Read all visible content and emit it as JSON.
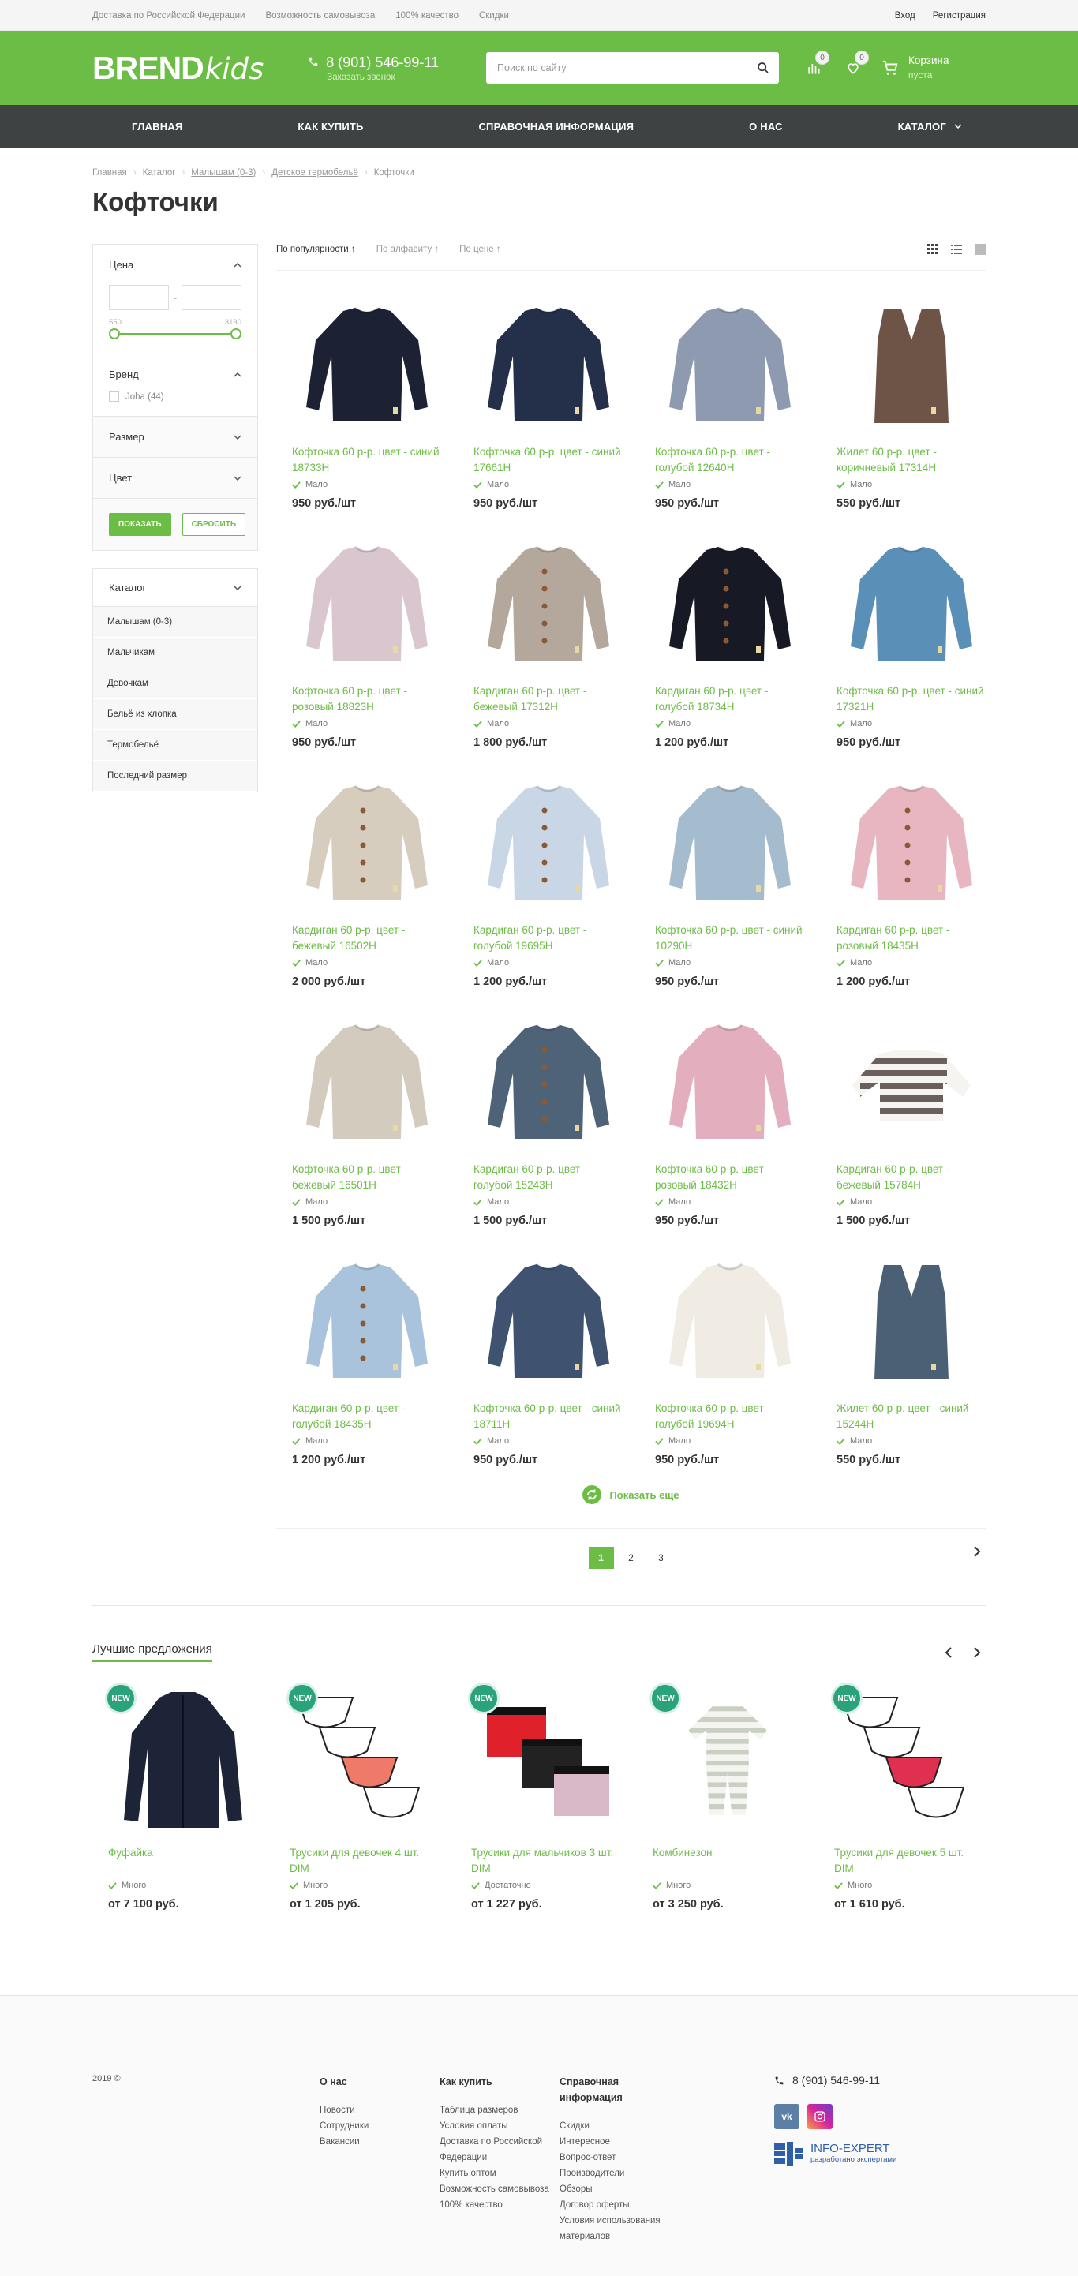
{
  "topbar": {
    "links": [
      "Доставка по Российской Федерации",
      "Возможность самовывоза",
      "100% качество",
      "Скидки"
    ],
    "login": "Вход",
    "register": "Регистрация"
  },
  "header": {
    "logo_brand": "BREND",
    "logo_kids": "kids",
    "phone": "8 (901) 546-99-11",
    "callback": "Заказать звонок",
    "search_placeholder": "Поиск по сайту",
    "compare_count": "0",
    "wishlist_count": "0",
    "cart_title": "Корзина",
    "cart_status": "пуста"
  },
  "nav": [
    "ГЛАВНАЯ",
    "КАК КУПИТЬ",
    "СПРАВОЧНАЯ ИНФОРМАЦИЯ",
    "О НАС",
    "КАТАЛОГ"
  ],
  "breadcrumbs": [
    "Главная",
    "Каталог",
    "Малышам (0-3)",
    "Детское термобельё",
    "Кофточки"
  ],
  "page_title": "Кофточки",
  "filter": {
    "price_label": "Цена",
    "price_min": "550",
    "price_max": "3130",
    "brand_label": "Бренд",
    "brand_option": "Joha (44)",
    "size_label": "Размер",
    "color_label": "Цвет",
    "show_button": "ПОКАЗАТЬ",
    "reset_button": "СБРОСИТЬ"
  },
  "catalog": {
    "title": "Каталог",
    "items": [
      "Малышам (0-3)",
      "Мальчикам",
      "Девочкам",
      "Бельё из хлопка",
      "Термобельё",
      "Последний размер"
    ]
  },
  "sort": {
    "popularity": "По популярности",
    "alphabet": "По алфавиту",
    "price": "По цене"
  },
  "products": [
    {
      "name": "Кофточка 60 р-р. цвет - синий 18733H",
      "avail": "Мало",
      "price": "950 руб./шт",
      "color": "#1c2233",
      "kind": "sweater"
    },
    {
      "name": "Кофточка 60 р-р. цвет - синий 17661H",
      "avail": "Мало",
      "price": "950 руб./шт",
      "color": "#242f4a",
      "kind": "sweater"
    },
    {
      "name": "Кофточка 60 р-р. цвет - голубой 12640H",
      "avail": "Мало",
      "price": "950 руб./шт",
      "color": "#8d9ab0",
      "kind": "sweater"
    },
    {
      "name": "Жилет 60 р-р. цвет - коричневый 17314H",
      "avail": "Мало",
      "price": "550 руб./шт",
      "color": "#6d5446",
      "kind": "vest"
    },
    {
      "name": "Кофточка 60 р-р. цвет - розовый 18823H",
      "avail": "Мало",
      "price": "950 руб./шт",
      "color": "#d9c6cf",
      "kind": "sweater"
    },
    {
      "name": "Кардиган 60 р-р. цвет - бежевый 17312H",
      "avail": "Мало",
      "price": "1 800 руб./шт",
      "color": "#b4a79c",
      "kind": "cardigan"
    },
    {
      "name": "Кардиган 60 р-р. цвет - голубой 18734H",
      "avail": "Мало",
      "price": "1 200 руб./шт",
      "color": "#171a25",
      "kind": "cardigan"
    },
    {
      "name": "Кофточка 60 р-р. цвет - синий 17321H",
      "avail": "Мало",
      "price": "950 руб./шт",
      "color": "#5a8fb8",
      "kind": "sweater"
    },
    {
      "name": "Кардиган 60 р-р. цвет - бежевый 16502H",
      "avail": "Мало",
      "price": "2 000 руб./шт",
      "color": "#d6cdbf",
      "kind": "cardigan"
    },
    {
      "name": "Кардиган 60 р-р. цвет - голубой 19695H",
      "avail": "Мало",
      "price": "1 200 руб./шт",
      "color": "#c9d6e6",
      "kind": "cardigan"
    },
    {
      "name": "Кофточка 60 р-р. цвет - синий 10290H",
      "avail": "Мало",
      "price": "950 руб./шт",
      "color": "#a4bccd",
      "kind": "sweater"
    },
    {
      "name": "Кардиган 60 р-р. цвет - розовый 18435H",
      "avail": "Мало",
      "price": "1 200 руб./шт",
      "color": "#e8b6c0",
      "kind": "cardigan"
    },
    {
      "name": "Кофточка 60 р-р. цвет - бежевый 16501H",
      "avail": "Мало",
      "price": "1 500 руб./шт",
      "color": "#d3cbbe",
      "kind": "sweater"
    },
    {
      "name": "Кардиган 60 р-р. цвет - голубой 15243H",
      "avail": "Мало",
      "price": "1 500 руб./шт",
      "color": "#4f6378",
      "kind": "cardigan"
    },
    {
      "name": "Кофточка 60 р-р. цвет - розовый 18432H",
      "avail": "Мало",
      "price": "950 руб./шт",
      "color": "#e3aebd",
      "kind": "sweater"
    },
    {
      "name": "Кардиган 60 р-р. цвет - бежевый 15784H",
      "avail": "Мало",
      "price": "1 500 руб./шт",
      "color": "#6a5f5a",
      "kind": "stripe"
    },
    {
      "name": "Кардиган 60 р-р. цвет - голубой 18435H",
      "avail": "Мало",
      "price": "1 200 руб./шт",
      "color": "#a9c3dc",
      "kind": "cardigan"
    },
    {
      "name": "Кофточка 60 р-р. цвет - синий 18711H",
      "avail": "Мало",
      "price": "950 руб./шт",
      "color": "#3f5370",
      "kind": "sweater"
    },
    {
      "name": "Кофточка 60 р-р. цвет - голубой 19694H",
      "avail": "Мало",
      "price": "950 руб./шт",
      "color": "#f0ebe3",
      "kind": "sweater"
    },
    {
      "name": "Жилет 60 р-р. цвет - синий 15244H",
      "avail": "Мало",
      "price": "550 руб./шт",
      "color": "#4c6075",
      "kind": "vest"
    }
  ],
  "show_more": "Показать еще",
  "pages": [
    "1",
    "2",
    "3"
  ],
  "best": {
    "title": "Лучшие предложения",
    "new_badge": "NEW",
    "items": [
      {
        "name": "Фуфайка",
        "avail": "Много",
        "price": "от 7 100 руб.",
        "kind": "jacket",
        "color": "#1d2438"
      },
      {
        "name": "Трусики для девочек 4 шт. DIM",
        "avail": "Много",
        "price": "от 1 205 руб.",
        "kind": "panties",
        "color": "#f07a6a"
      },
      {
        "name": "Трусики для мальчиков 3 шт. DIM",
        "avail": "Достаточно",
        "price": "от 1 227 руб.",
        "kind": "boxers",
        "color": "#e0202a"
      },
      {
        "name": "Комбинезон",
        "avail": "Много",
        "price": "от 3 250 руб.",
        "kind": "romper",
        "color": "#c9cfc2"
      },
      {
        "name": "Трусики для девочек 5 шт. DIM",
        "avail": "Много",
        "price": "от 1 610 руб.",
        "kind": "panties",
        "color": "#e03050"
      }
    ]
  },
  "footer": {
    "copyright": "2019 ©",
    "col1": {
      "title": "О нас",
      "items": [
        "Новости",
        "Сотрудники",
        "Вакансии"
      ]
    },
    "col2": {
      "title": "Как купить",
      "items": [
        "Таблица размеров",
        "Условия оплаты",
        "Доставка по Российской Федерации",
        "Купить оптом",
        "Возможность самовывоза",
        "100% качество"
      ]
    },
    "col3": {
      "title": "Справочная информация",
      "items": [
        "Скидки",
        "Интересное",
        "Вопрос-ответ",
        "Производители",
        "Обзоры",
        "Договор оферты",
        "Условия использования материалов"
      ]
    },
    "phone": "8 (901) 546-99-11",
    "vk": "vk",
    "dev_name": "INFO-EXPERT",
    "dev_sub": "разработано экспертами"
  },
  "colors": {
    "accent": "#6cbd45",
    "nav": "#3f4243",
    "new_badge": "#2aa37a"
  }
}
